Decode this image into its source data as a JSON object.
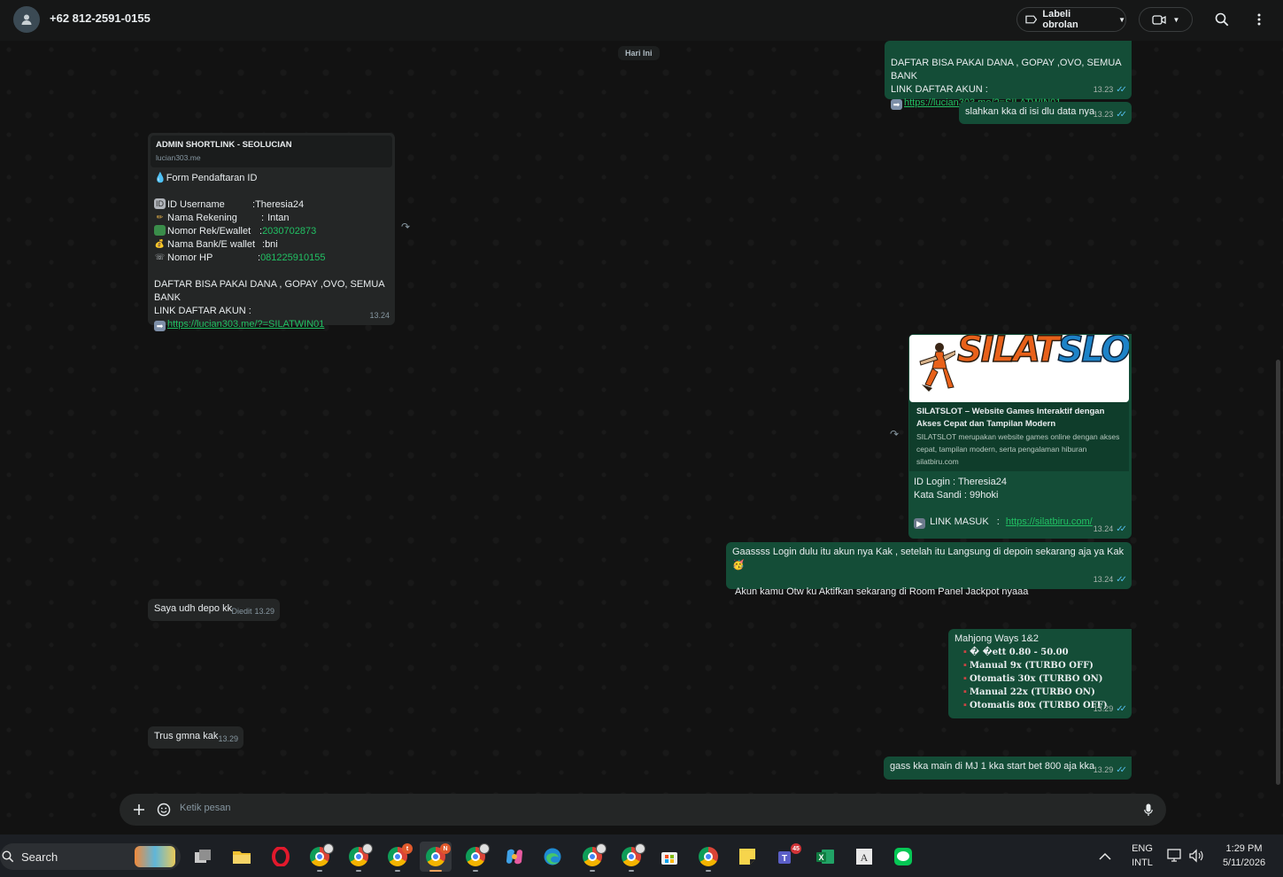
{
  "header": {
    "contact_name": "+62 812-2591-0155",
    "label_button": "Labeli obrolan"
  },
  "chat": {
    "date_chip": "Hari Ini",
    "messages": [
      {
        "lines": [
          "DAFTAR BISA PAKAI DANA , GOPAY ,OVO, SEMUA BANK",
          "LINK DAFTAR AKUN :"
        ],
        "link": "https://lucian303.me/?=SILATWIN01",
        "time": "13.23"
      },
      {
        "text": "slahkan kka di isi dlu data nya",
        "time": "13.23"
      },
      {
        "preview_title": "ADMIN SHORTLINK - SEOLUCIAN",
        "preview_domain": "lucian303.me",
        "form_title": "Form Pendaftaran ID",
        "fields": [
          {
            "label": "ID Username",
            "sep": ":",
            "value": "Theresia24"
          },
          {
            "label": "Nama Rekening",
            "sep": ":",
            "value": "Intan"
          },
          {
            "label": "Nomor Rek/Ewallet",
            "sep": ":",
            "value": "2030702873"
          },
          {
            "label": "Nama Bank/E wallet",
            "sep": ":",
            "value": "bni"
          },
          {
            "label": "Nomor HP",
            "sep": ":",
            "value": "081225910155"
          }
        ],
        "lines": [
          "DAFTAR BISA PAKAI DANA , GOPAY ,OVO, SEMUA BANK",
          "LINK DAFTAR AKUN :"
        ],
        "link": "https://lucian303.me/?=SILATWIN01",
        "time": "13.24"
      },
      {
        "image_logo": [
          "SILAT",
          "SLOT"
        ],
        "card_title": "SILATSLOT – Website Games Interaktif dengan Akses Cepat dan Tampilan Modern",
        "card_desc": "SILATSLOT merupakan website games online dengan akses cepat, tampilan modern, serta pengalaman hiburan",
        "card_domain": "silatbiru.com",
        "login_line": "ID Login : Theresia24",
        "password_line": "Kata Sandi : 99hoki",
        "link_label": "LINK MASUK",
        "link_sep": ":",
        "link": "https://silatbiru.com/",
        "time": "13.24"
      },
      {
        "line1": "Gaassss Login dulu itu akun nya Kak  , setelah itu Langsung di depoin sekarang aja ya Kak",
        "emoji": "🥳",
        "line2": "Akun kamu Otw ku Aktifkan sekarang di Room Panel Jackpot nyaaa",
        "time": "13.24"
      },
      {
        "text": "Saya udh depo kk",
        "edited": "Diedit",
        "time": "13.29"
      },
      {
        "title": "Mahjong Ways 1&2",
        "rows": [
          "� �ett 0.80 - 50.00",
          "Manual    9x (TURBO OFF)",
          "Otomatis 30x (TURBO ON)",
          "Manual   22x (TURBO ON)",
          "Otomatis 80x (TURBO OFF)"
        ],
        "time": "13.29"
      },
      {
        "text": "Trus gmna kak",
        "time": "13.29"
      },
      {
        "text": "gass kka main di MJ 1 kka start bet 800 aja kka",
        "time": "13.29"
      }
    ]
  },
  "composer": {
    "placeholder": "Ketik pesan"
  },
  "taskbar": {
    "search_label": "Search",
    "badges": {
      "chrome_3": "t",
      "chrome_4": "N",
      "teams": "45"
    },
    "lang_top": "ENG",
    "lang_bottom": "INTL",
    "time": "1:29 PM",
    "date": "5/11/2026"
  },
  "colors": {
    "outgoing_bubble": "#144d37",
    "incoming_bubble": "#242626",
    "link_green": "#21c063",
    "tick_blue": "#53bdeb"
  }
}
